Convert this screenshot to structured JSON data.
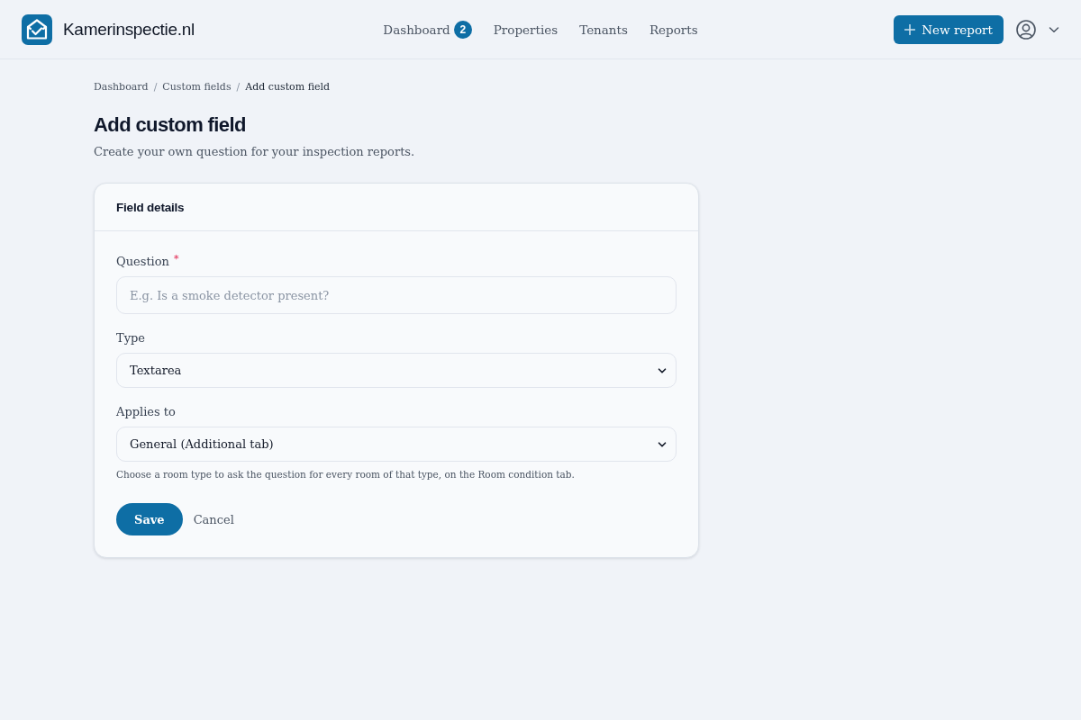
{
  "header": {
    "brand": "Kamerinspectie.nl",
    "nav": [
      {
        "label": "Dashboard",
        "badge": "2",
        "selected": false
      },
      {
        "label": "Properties",
        "selected": false
      },
      {
        "label": "Tenants",
        "selected": false
      },
      {
        "label": "Reports",
        "selected": false
      }
    ],
    "new_report_button": "New report"
  },
  "breadcrumb": {
    "separator": "/",
    "items": [
      {
        "label": "Dashboard",
        "current": false
      },
      {
        "label": "Custom fields",
        "current": false
      },
      {
        "label": "Add custom field",
        "current": true
      }
    ]
  },
  "page": {
    "title": "Add custom field",
    "subtitle": "Create your own question for your inspection reports."
  },
  "card": {
    "title": "Field details",
    "fields": [
      {
        "kind": "input",
        "label": "Question",
        "required_mark": "*",
        "placeholder": "E.g. Is a smoke detector present?"
      },
      {
        "kind": "select",
        "label": "Type",
        "value": "Textarea"
      },
      {
        "kind": "select",
        "label": "Applies to",
        "value": "General (Additional tab)",
        "help": "Choose a room type to ask the question for every room of that type, on the Room condition tab."
      }
    ],
    "actions": {
      "save": "Save",
      "cancel": "Cancel"
    }
  }
}
